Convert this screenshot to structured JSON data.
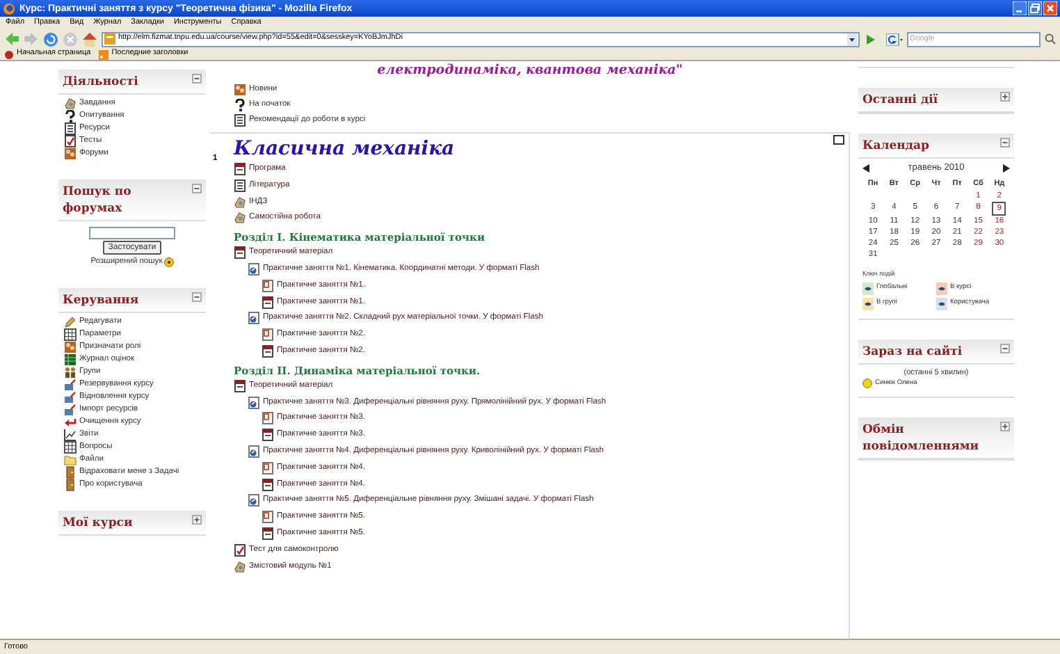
{
  "window": {
    "title": "Курс: Практичні заняття з курсу \"Теоретична фізика\" - Mozilla Firefox"
  },
  "menu": [
    "Файл",
    "Правка",
    "Вид",
    "Журнал",
    "Закладки",
    "Инструменты",
    "Справка"
  ],
  "address": {
    "url": "http://elm.fizmat.tnpu.edu.ua/course/view.php?id=55&edit=0&sesskey=KYoBJmJhDi"
  },
  "search": {
    "placeholder": "Google"
  },
  "bookmarks": [
    {
      "kind": "home",
      "label": "Начальная страница"
    },
    {
      "kind": "feed",
      "label": "Последние заголовки"
    }
  ],
  "left_blocks": [
    {
      "kind": "list",
      "title": "Діяльності",
      "expanded": true,
      "items": [
        {
          "kind": "assignment",
          "label": "Завдання"
        },
        {
          "kind": "help",
          "label": "Опитування"
        },
        {
          "kind": "page",
          "label": "Ресурси"
        },
        {
          "kind": "quiz",
          "label": "Тесты"
        },
        {
          "kind": "news",
          "label": "Форуми"
        }
      ]
    },
    {
      "kind": "search",
      "title": "Пошук по форумах",
      "expanded": true,
      "button": "Застосувати",
      "link": "Розширений пошук"
    },
    {
      "kind": "list",
      "title": "Керування",
      "expanded": true,
      "items": [
        {
          "kind": "pencil",
          "label": "Редагувати"
        },
        {
          "kind": "grid",
          "label": "Параметри"
        },
        {
          "kind": "news",
          "label": "Призначати ролі"
        },
        {
          "kind": "table",
          "label": "Журнал оцінок"
        },
        {
          "kind": "people",
          "label": "Групи"
        },
        {
          "kind": "disk",
          "label": "Резервування курсу"
        },
        {
          "kind": "disk",
          "label": "Відновлення курсу"
        },
        {
          "kind": "disk",
          "label": "Імпорт ресурсів"
        },
        {
          "kind": "arrow",
          "label": "Очищення курсу"
        },
        {
          "kind": "chart",
          "label": "Звіти"
        },
        {
          "kind": "grid",
          "label": "Вопросы"
        },
        {
          "kind": "folder",
          "label": "Файли"
        },
        {
          "kind": "door",
          "label": "Відраховати мене з Задачі"
        },
        {
          "kind": "door",
          "label": "Про користувача"
        }
      ]
    },
    {
      "kind": "list",
      "title": "Мої курси",
      "expanded": false
    }
  ],
  "course": {
    "header": "електродинаміка, квантова механіка\"",
    "top_items": [
      {
        "kind": "news",
        "label": "Новини"
      },
      {
        "kind": "help",
        "label": "На початок"
      },
      {
        "kind": "page",
        "label": "Рекомендації до роботи в курсі"
      }
    ],
    "section": {
      "number": "1",
      "title": "Класична механіка",
      "items": [
        {
          "kind": "pdf",
          "label": "Програма"
        },
        {
          "kind": "page",
          "label": "Література"
        },
        {
          "kind": "assignment",
          "label": "ІНДЗ"
        },
        {
          "kind": "assignment",
          "label": "Самостійна робота"
        },
        {
          "kind": "heading",
          "label": "Розділ І. Кінематика матеріальної точки"
        },
        {
          "kind": "pdf",
          "label": "Теоретичний матеріал",
          "children": [
            {
              "kind": "link",
              "label": "Практичне заняття №1. Кінематика. Координатні методи. У форматі Flash",
              "children": [
                {
                  "kind": "ppt",
                  "label": "Практичне заняття №1."
                },
                {
                  "kind": "pdf",
                  "label": "Практичне заняття №1."
                }
              ]
            },
            {
              "kind": "link",
              "label": "Практичне заняття №2. Складний рух матеріальної точки. У форматі Flash",
              "children": [
                {
                  "kind": "ppt",
                  "label": "Практичне заняття №2."
                },
                {
                  "kind": "pdf",
                  "label": "Практичне заняття №2."
                }
              ]
            }
          ]
        },
        {
          "kind": "heading",
          "label": "Розділ ІІ. Динаміка матеріальної точки."
        },
        {
          "kind": "pdf",
          "label": "Теоретичний матеріал",
          "children": [
            {
              "kind": "link",
              "label": "Практичне заняття №3. Диференціальні рівняння руху. Прямолінійний рух. У форматі Flash",
              "children": [
                {
                  "kind": "ppt",
                  "label": "Практичне заняття №3."
                },
                {
                  "kind": "pdf",
                  "label": "Практичне заняття №3."
                }
              ]
            },
            {
              "kind": "link",
              "label": "Практичне заняття №4. Диференціальні рівняння руху. Криволінійний рух. У форматі Flash",
              "children": [
                {
                  "kind": "ppt",
                  "label": "Практичне заняття №4."
                },
                {
                  "kind": "pdf",
                  "label": "Практичне заняття №4."
                }
              ]
            },
            {
              "kind": "link",
              "label": "Практичне заняття №5. Диференціальне рівняння руху. Змішані задачі. У форматі Flash",
              "children": [
                {
                  "kind": "ppt",
                  "label": "Практичне заняття №5."
                },
                {
                  "kind": "pdf",
                  "label": "Практичне заняття №5."
                }
              ]
            }
          ]
        },
        {
          "kind": "quiz",
          "label": "Тест для самоконтролю"
        },
        {
          "kind": "assignment",
          "label": "Змістовий модуль №1"
        }
      ]
    }
  },
  "right_blocks": [
    {
      "kind": "plain",
      "title": "Останні дії",
      "expanded": false
    },
    {
      "kind": "calendar",
      "title": "Календар",
      "expanded": true,
      "month": "травень 2010",
      "weekdays": [
        "Пн",
        "Вт",
        "Ср",
        "Чт",
        "Пт",
        "Сб",
        "Нд"
      ],
      "weeks": [
        {
          "kind": "first",
          "days": [
            {
              "label": "1",
              "today": false
            },
            {
              "label": "2",
              "today": false
            }
          ]
        },
        {
          "kind": "week",
          "days": [
            {
              "label": "3",
              "today": false
            },
            {
              "label": "4",
              "today": false
            },
            {
              "label": "5",
              "today": false
            },
            {
              "label": "6",
              "today": false
            },
            {
              "label": "7",
              "today": false
            },
            {
              "label": "8",
              "today": false
            },
            {
              "label": "9",
              "today": true
            }
          ]
        },
        {
          "kind": "week",
          "days": [
            {
              "label": "10",
              "today": false
            },
            {
              "label": "11",
              "today": false
            },
            {
              "label": "12",
              "today": false
            },
            {
              "label": "13",
              "today": false
            },
            {
              "label": "14",
              "today": false
            },
            {
              "label": "15",
              "today": false
            },
            {
              "label": "16",
              "today": false
            }
          ]
        },
        {
          "kind": "week",
          "days": [
            {
              "label": "17",
              "today": false
            },
            {
              "label": "18",
              "today": false
            },
            {
              "label": "19",
              "today": false
            },
            {
              "label": "20",
              "today": false
            },
            {
              "label": "21",
              "today": false
            },
            {
              "label": "22",
              "today": false
            },
            {
              "label": "23",
              "today": false
            }
          ]
        },
        {
          "kind": "week",
          "days": [
            {
              "label": "24",
              "today": false
            },
            {
              "label": "25",
              "today": false
            },
            {
              "label": "26",
              "today": false
            },
            {
              "label": "27",
              "today": false
            },
            {
              "label": "28",
              "today": false
            },
            {
              "label": "29",
              "today": false
            },
            {
              "label": "30",
              "today": false
            }
          ]
        },
        {
          "kind": "week",
          "days": [
            {
              "label": "31",
              "today": false
            }
          ]
        }
      ],
      "legend_title": "Ключ подій",
      "legend": [
        {
          "label": "Глобальні",
          "color": "#cfeac8"
        },
        {
          "label": "В курсі",
          "color": "#f8cdb8"
        },
        {
          "label": "В групі",
          "color": "#fde3a8"
        },
        {
          "label": "Користувача",
          "color": "#d6e0ea"
        }
      ]
    },
    {
      "kind": "online",
      "title": "Зараз на сайті",
      "expanded": true,
      "note": "(останні 5 хвилин)",
      "users": [
        "Синюк Олена"
      ]
    },
    {
      "kind": "plain",
      "title": "Обмін повідомленнями",
      "expanded": false
    }
  ],
  "status_bar": "Готово"
}
